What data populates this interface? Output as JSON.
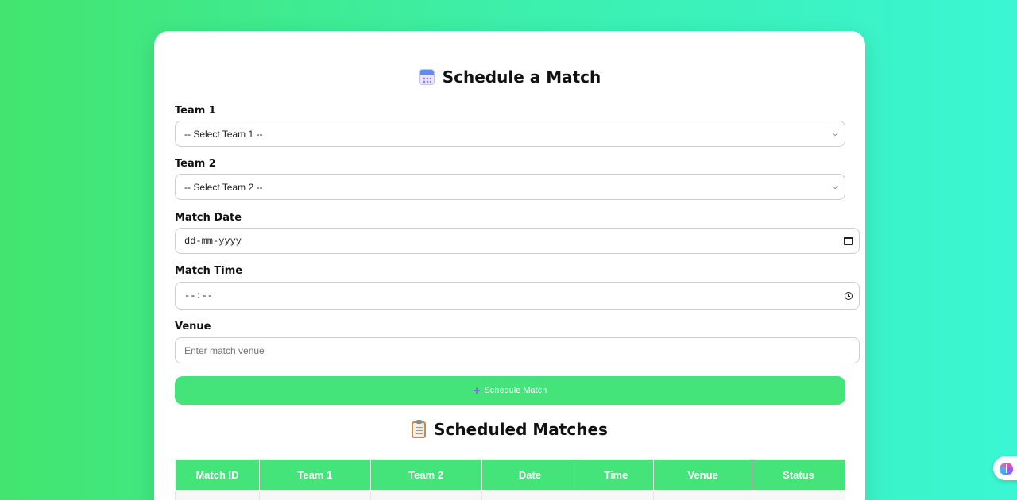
{
  "form": {
    "title": "Schedule a Match",
    "title_icon": "calendar-icon",
    "team1": {
      "label": "Team 1",
      "selected": "-- Select Team 1 --"
    },
    "team2": {
      "label": "Team 2",
      "selected": "-- Select Team 2 --"
    },
    "date": {
      "label": "Match Date",
      "placeholder": "dd-mm-yyyy"
    },
    "time": {
      "label": "Match Time",
      "placeholder": "--:--"
    },
    "venue": {
      "label": "Venue",
      "placeholder": "Enter match venue"
    },
    "submit_label": "Schedule Match",
    "submit_icon": "plus-icon"
  },
  "matches": {
    "title": "Scheduled Matches",
    "title_icon": "clipboard-icon",
    "columns": [
      "Match ID",
      "Team 1",
      "Team 2",
      "Date",
      "Time",
      "Venue",
      "Status"
    ]
  },
  "colors": {
    "accent": "#45e47b",
    "background_start": "#43e56f",
    "background_end": "#3af6d3",
    "submit_icon": "#8b5cf6"
  },
  "widget": {
    "icon": "brain-icon"
  }
}
